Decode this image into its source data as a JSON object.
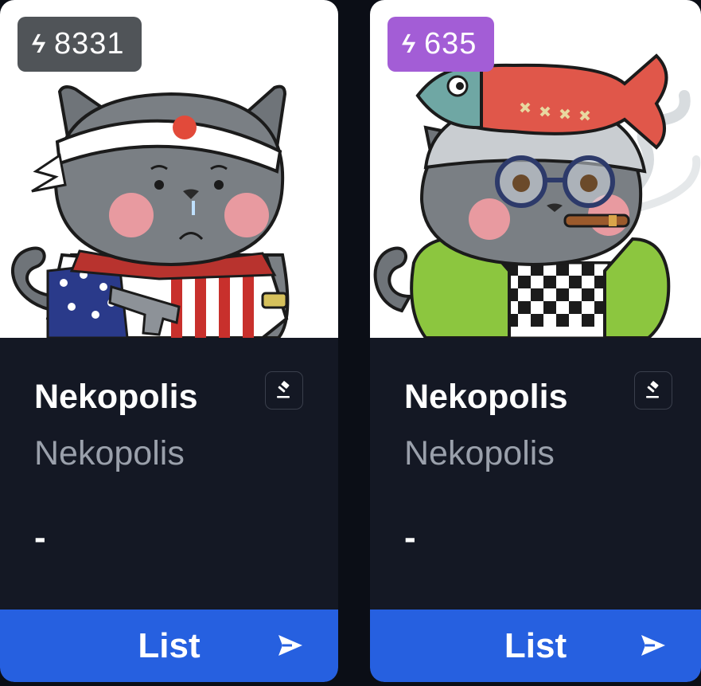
{
  "cards": [
    {
      "rank": "8331",
      "rank_badge_color": "#505458",
      "title": "Nekopolis",
      "collection": "Nekopolis",
      "price": "-",
      "action_label": "List",
      "icons": {
        "rank": "lightning-bolt-icon",
        "bid": "gavel-icon",
        "action": "send-icon"
      }
    },
    {
      "rank": "635",
      "rank_badge_color": "#a35dd6",
      "title": "Nekopolis",
      "collection": "Nekopolis",
      "price": "-",
      "action_label": "List",
      "icons": {
        "rank": "lightning-bolt-icon",
        "bid": "gavel-icon",
        "action": "send-icon"
      }
    }
  ],
  "colors": {
    "background": "#0b0e16",
    "card": "#141824",
    "button": "#2660e0",
    "muted_text": "#9aa0ab"
  }
}
